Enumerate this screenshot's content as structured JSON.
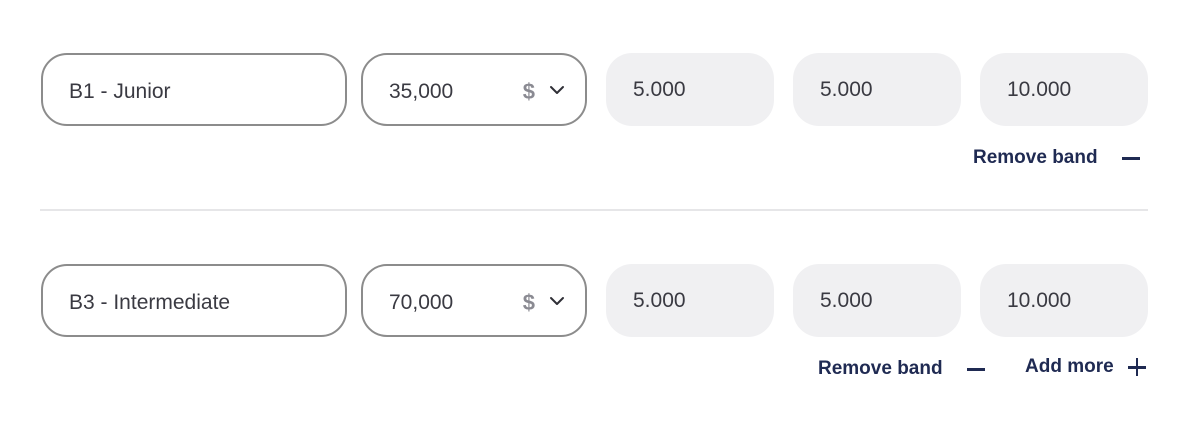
{
  "bands": [
    {
      "name": "B1 - Junior",
      "salary": "35,000",
      "currency_symbol": "$",
      "values": [
        "5.000",
        "5.000",
        "10.000"
      ],
      "remove_label": "Remove band"
    },
    {
      "name": "B3 - Intermediate",
      "salary": "70,000",
      "currency_symbol": "$",
      "values": [
        "5.000",
        "5.000",
        "10.000"
      ],
      "remove_label": "Remove band"
    }
  ],
  "add_more_label": "Add more",
  "icons": {
    "currency": "dollar-icon",
    "dropdown": "chevron-down-icon",
    "remove": "minus-icon",
    "add": "plus-icon"
  },
  "colors": {
    "action_text": "#1f2a52",
    "field_border": "#8c8c8c",
    "readonly_bg": "#f0f0f2"
  }
}
